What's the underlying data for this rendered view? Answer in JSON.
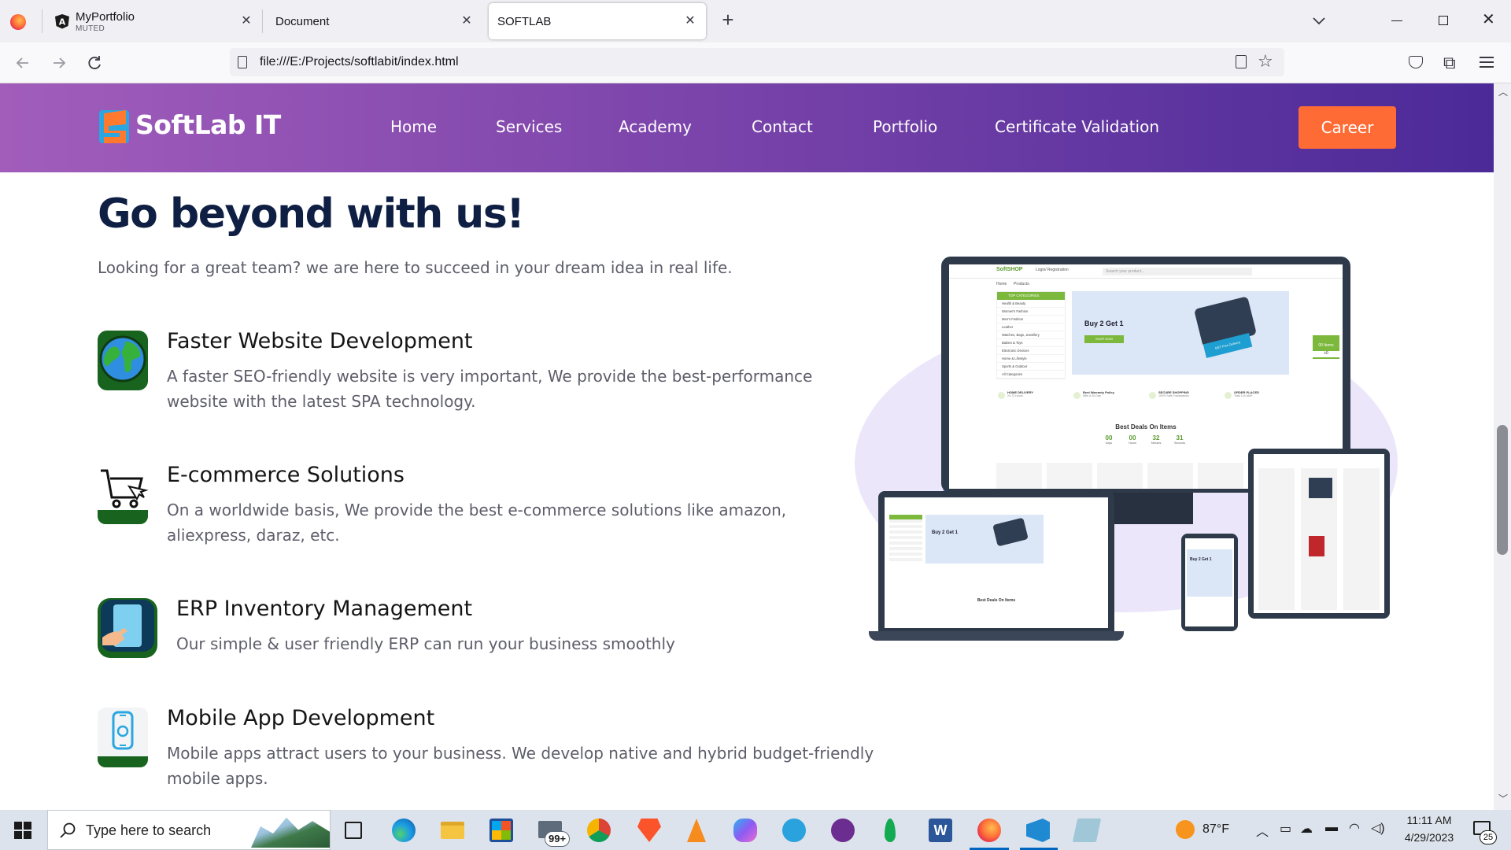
{
  "browser": {
    "tabs": [
      {
        "title": "MyPortfolio",
        "subtitle": "MUTED"
      },
      {
        "title": "Document"
      },
      {
        "title": "SOFTLAB"
      }
    ],
    "url": "file:///E:/Projects/softlabit/index.html"
  },
  "site": {
    "brand": "SoftLab IT",
    "nav": [
      "Home",
      "Services",
      "Academy",
      "Contact",
      "Portfolio",
      "Certificate Validation"
    ],
    "career_label": "Career"
  },
  "hero": {
    "title": "Go beyond with us!",
    "subtitle": "Looking for a great team? we are here to succeed in your dream idea in real life."
  },
  "features": [
    {
      "icon": "globe-icon",
      "title": "Faster Website Development",
      "desc": "A faster SEO-friendly website is very important, We provide the best-performance website with the latest SPA technology."
    },
    {
      "icon": "shopping-cart-icon",
      "title": "E-commerce Solutions",
      "desc": "On a worldwide basis, We provide the best e-commerce solutions like amazon, aliexpress, daraz, etc."
    },
    {
      "icon": "tablet-touch-icon",
      "title": "ERP Inventory Management",
      "desc": "Our simple & user friendly ERP can run your business smoothly"
    },
    {
      "icon": "mobile-phone-icon",
      "title": "Mobile App Development",
      "desc": "Mobile apps attract users to your business. We develop native and hybrid budget-friendly mobile apps."
    }
  ],
  "mockup": {
    "brand": "SoftSHOP",
    "login": "Login/ Registration",
    "search_placeholder": "Search your product...",
    "menu": [
      "Home",
      "Products"
    ],
    "categories_header": "TOP CATEGORIES",
    "categories": [
      "Health & Beauty",
      "Women's Fashion",
      "Men's Fashion",
      "Leather",
      "Watches, Bags, Jewellery",
      "Babies & Toys",
      "Electronic Devices",
      "Home & Lifestyle",
      "Sports & Outdoor",
      "All Categories"
    ],
    "banner_title": "Buy 2 Get 1",
    "banner_button": "SHOP NOW",
    "banner_tag": "GET Free Delivery",
    "cart_label": "00 Items",
    "cart_total": "৳0",
    "perks": [
      {
        "title": "HOME DELIVERY",
        "sub": "24-72 Hours"
      },
      {
        "title": "Best Warranty Policy",
        "sub": "With A 30-Day"
      },
      {
        "title": "SECURE SHOPPING",
        "sub": "100% Safe Transactions"
      },
      {
        "title": "ORDER PLACED",
        "sub": "Total 124,568+"
      }
    ],
    "deals_prefix": "Best Deals",
    "deals_suffix": "On Items",
    "countdown": [
      {
        "v": "00",
        "l": "Days"
      },
      {
        "v": "00",
        "l": "Hours"
      },
      {
        "v": "32",
        "l": "Minutes"
      },
      {
        "v": "31",
        "l": "Seconds"
      }
    ]
  },
  "taskbar": {
    "search_placeholder": "Type here to search",
    "mail_badge": "99+",
    "weather": "87°F",
    "time": "11:11 AM",
    "date": "4/29/2023",
    "notifications": "25"
  },
  "colors": {
    "header_gradient": [
      "#a25dbb",
      "#4b2a98"
    ],
    "career": "#ff6b35",
    "heading": "#0f1e43",
    "mockup_green": "#7cb83b"
  }
}
